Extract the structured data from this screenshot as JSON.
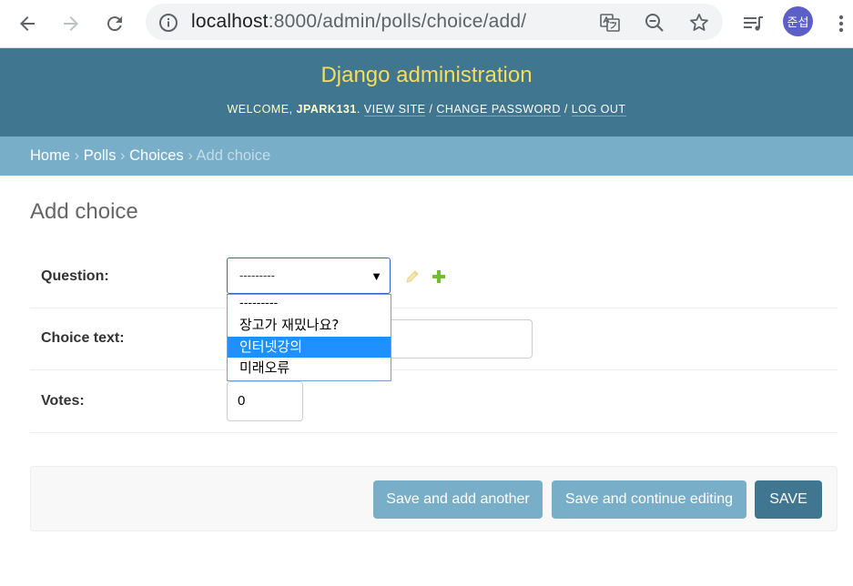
{
  "browser": {
    "url_host": "localhost",
    "url_rest": ":8000/admin/polls/choice/add/",
    "profile_initials": "준섭"
  },
  "header": {
    "brand": "Django administration",
    "welcome": "WELCOME, ",
    "username": "JPARK131",
    "view_site": "VIEW SITE",
    "change_password": "CHANGE PASSWORD",
    "log_out": "LOG OUT",
    "sep": " / "
  },
  "breadcrumbs": {
    "home": "Home",
    "polls": "Polls",
    "choices": "Choices",
    "current": "Add choice",
    "sep": " › "
  },
  "page": {
    "title": "Add choice"
  },
  "form": {
    "question": {
      "label": "Question:",
      "selected": "---------",
      "options": [
        "---------",
        "장고가 재밌나요?",
        "인터넷강의",
        "미래오류"
      ],
      "highlighted_index": 2
    },
    "choice_text": {
      "label": "Choice text:",
      "value": ""
    },
    "votes": {
      "label": "Votes:",
      "value": "0"
    }
  },
  "actions": {
    "save_add_another": "Save and add another",
    "save_continue": "Save and continue editing",
    "save": "SAVE"
  },
  "colors": {
    "header_bg": "#417690",
    "breadcrumb_bg": "#79aec8",
    "brand_yellow": "#f5dd5d",
    "highlight": "#1e90ff"
  }
}
